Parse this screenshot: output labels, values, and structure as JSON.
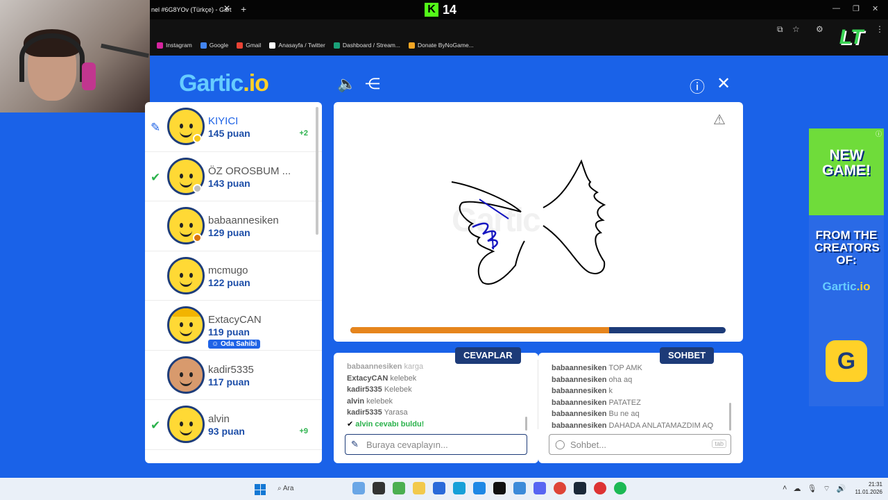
{
  "browser": {
    "tab_title": "nel #6G8YOv (Türkçe) - Gart",
    "kick_viewers": "14",
    "bookmarks": [
      {
        "label": "Instagram",
        "color": "#d6249f"
      },
      {
        "label": "Google",
        "color": "#4285f4"
      },
      {
        "label": "Gmail",
        "color": "#ea4335"
      },
      {
        "label": "Anasayfa / Twitter",
        "color": "#ffffff"
      },
      {
        "label": "Dashboard / Stream...",
        "color": "#1aa179"
      },
      {
        "label": "Donate ByNoGame...",
        "color": "#f5a623"
      }
    ]
  },
  "game": {
    "logo_main": "Gartic",
    "logo_suffix": ".io",
    "timer_progress_percent": 69,
    "players": [
      {
        "name": "KIYICI",
        "points": "145 puan",
        "bonus": "+2",
        "status": "pencil",
        "medal": "#f5c518",
        "active": true
      },
      {
        "name": "ÖZ OROSBUM ...",
        "points": "143 puan",
        "bonus": "",
        "status": "check",
        "medal": "#bdbdbd",
        "active": false
      },
      {
        "name": "babaannesiken",
        "points": "129 puan",
        "bonus": "",
        "status": "",
        "medal": "#d9730d",
        "active": false
      },
      {
        "name": "mcmugo",
        "points": "122 puan",
        "bonus": "",
        "status": "",
        "medal": "",
        "active": false
      },
      {
        "name": "ExtacyCAN",
        "points": "119 puan",
        "bonus": "",
        "status": "",
        "medal": "",
        "active": false,
        "badge": "Oda Sahibi"
      },
      {
        "name": "kadir5335",
        "points": "117 puan",
        "bonus": "",
        "status": "",
        "medal": "",
        "active": false
      },
      {
        "name": "alvin",
        "points": "93 puan",
        "bonus": "+9",
        "status": "check",
        "medal": "",
        "active": false
      }
    ],
    "answers": {
      "label": "CEVAPLAR",
      "messages": [
        {
          "author": "babaannesiken",
          "text": "karga",
          "faded": true
        },
        {
          "author": "ExtacyCAN",
          "text": "kelebek"
        },
        {
          "author": "kadir5335",
          "text": "Kelebek"
        },
        {
          "author": "alvin",
          "text": "kelebek"
        },
        {
          "author": "kadir5335",
          "text": "Yarasa"
        },
        {
          "author": "alvin",
          "text": "cevabı buldu!",
          "found": true
        }
      ],
      "placeholder": "Buraya cevaplayın..."
    },
    "chat": {
      "label": "SOHBET",
      "messages": [
        {
          "author": "babaannesiken",
          "text": "TOP AMK"
        },
        {
          "author": "babaannesiken",
          "text": "oha aq"
        },
        {
          "author": "babaannesiken",
          "text": "k"
        },
        {
          "author": "babaannesiken",
          "text": "PATATEZ"
        },
        {
          "author": "babaannesiken",
          "text": "Bu ne aq"
        },
        {
          "author": "babaannesiken",
          "text": "DAHADA ANLATAMAZDIM AQ"
        }
      ],
      "placeholder": "Sohbet...",
      "tab_hint": "tab"
    }
  },
  "ad": {
    "headline": "NEW GAME!",
    "subline": "FROM THE CREATORS OF:",
    "logo_main": "Gartic",
    "logo_suffix": ".io"
  },
  "taskbar": {
    "search_label": "Ara",
    "time": "21:31",
    "date": "11.01.2026"
  }
}
